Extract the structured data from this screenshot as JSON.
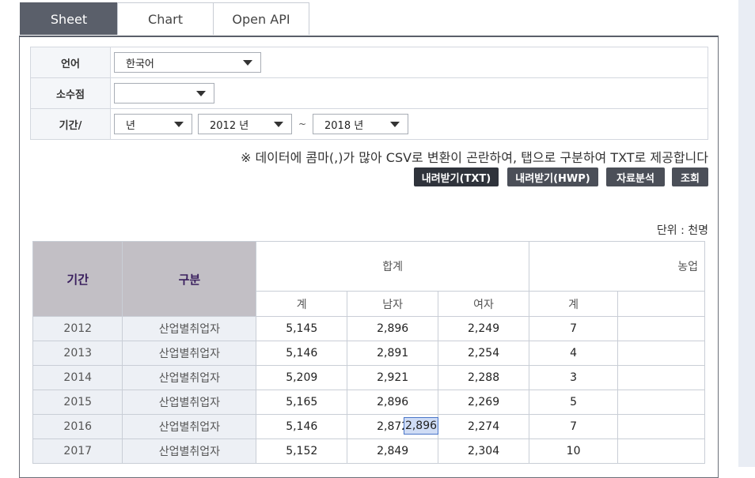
{
  "tabs": [
    "Sheet",
    "Chart",
    "Open API"
  ],
  "options": {
    "language_label": "언어",
    "language_value": "한국어",
    "decimal_label": "소수점",
    "decimal_value": "",
    "period_label": "기간/",
    "period_unit": "년",
    "period_start": "2012 년",
    "period_end": "2018 년",
    "tilde": "~"
  },
  "notice": "※ 데이터에 콤마(,)가 많아 CSV로 변환이 곤란하여, 탭으로 구분하여 TXT로 제공합니다",
  "buttons": {
    "txt": "내려받기(TXT)",
    "hwp": "내려받기(HWP)",
    "analysis": "자료분석",
    "search": "조회"
  },
  "unit": "단위 : 천명",
  "table": {
    "h_period": "기간",
    "h_category": "구분",
    "h_total": "합계",
    "h_agri": "농업",
    "sub": [
      "계",
      "남자",
      "여자",
      "계"
    ],
    "rows": [
      {
        "year": "2012",
        "cat": "산업별취업자",
        "v": [
          "5,145",
          "2,896",
          "2,249",
          "7"
        ]
      },
      {
        "year": "2013",
        "cat": "산업별취업자",
        "v": [
          "5,146",
          "2,891",
          "2,254",
          "4"
        ]
      },
      {
        "year": "2014",
        "cat": "산업별취업자",
        "v": [
          "5,209",
          "2,921",
          "2,288",
          "3"
        ]
      },
      {
        "year": "2015",
        "cat": "산업별취업자",
        "v": [
          "5,165",
          "2,896",
          "2,269",
          "5"
        ]
      },
      {
        "year": "2016",
        "cat": "산업별취업자",
        "v": [
          "5,146",
          "2,872",
          "2,274",
          "7"
        ]
      },
      {
        "year": "2017",
        "cat": "산업별취업자",
        "v": [
          "5,152",
          "2,849",
          "2,304",
          "10"
        ]
      }
    ]
  },
  "edit_cell_value": "2,896"
}
